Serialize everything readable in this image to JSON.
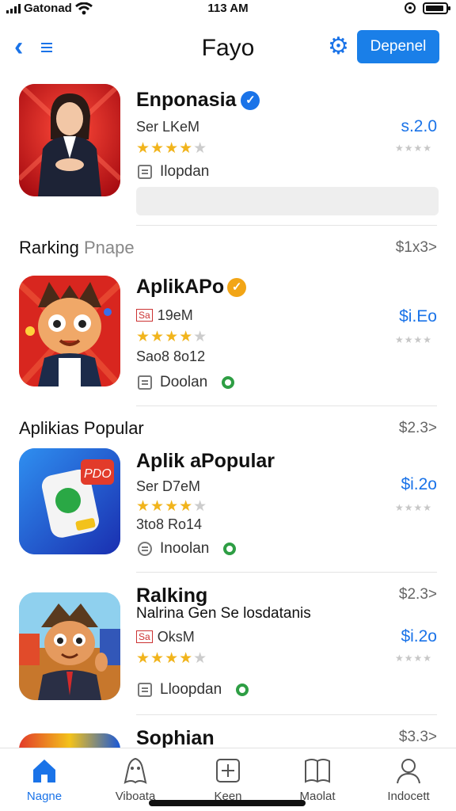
{
  "status_bar": {
    "carrier": "Gatonad",
    "time": "113 AM"
  },
  "nav": {
    "back_icon": "chevron-left-icon",
    "title": "Fayo",
    "settings_icon": "gear-icon",
    "action_label": "Depenel"
  },
  "featured": {
    "name": "Enponasia",
    "sub": "Ser LKeM",
    "rating": 4,
    "download_label": "Ilopdan",
    "price": "s.2.0"
  },
  "sections": [
    {
      "title_main": "Rarking",
      "title_light": "Pnape",
      "more": "$1x3>"
    },
    {
      "title_main": "Aplikias Popular",
      "title_light": "",
      "more": "$2.3>"
    }
  ],
  "apps": [
    {
      "name": "AplikAPo",
      "tag": "Sa",
      "sub": "19eM",
      "extra": "Sao8 8o12",
      "rating": 4,
      "download_label": "Doolan",
      "price": "$i.Eo"
    },
    {
      "name": "Aplik aPopular",
      "tag": "",
      "sub": "Ser D7eM",
      "extra": "3to8 Ro14",
      "rating": 4,
      "download_label": "Inoolan",
      "price": "$i.2o"
    },
    {
      "name": "Ralking",
      "tag": "Sa",
      "sub": "OksM",
      "desc": "Nalrina Gen Se losdatanis",
      "rating": 4,
      "download_label": "Lloopdan",
      "price": "$i.2o",
      "more": "$2.3>"
    },
    {
      "name": "Sophian",
      "more": "$3.3>"
    }
  ],
  "tabs": [
    {
      "label": "Nagne",
      "icon": "home-icon",
      "active": true
    },
    {
      "label": "Viboata",
      "icon": "character-icon",
      "active": false
    },
    {
      "label": "Keen",
      "icon": "add-box-icon",
      "active": false
    },
    {
      "label": "Maolat",
      "icon": "book-icon",
      "active": false
    },
    {
      "label": "Indocett",
      "icon": "profile-icon",
      "active": false
    }
  ],
  "colors": {
    "accent": "#1a73e8",
    "star": "#f1b41c",
    "green_pin": "#2e9e44"
  }
}
